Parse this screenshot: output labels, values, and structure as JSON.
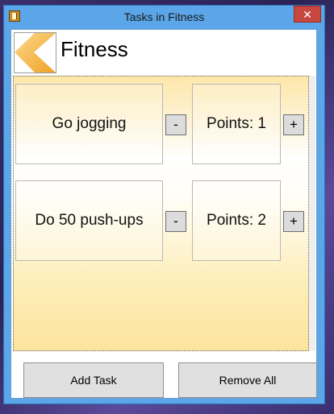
{
  "window": {
    "title": "Tasks in Fitness",
    "close_label": "✕"
  },
  "header": {
    "title": "Fitness"
  },
  "tasks": [
    {
      "name": "Go jogging",
      "points_label": "Points: 1",
      "minus": "-",
      "plus": "+"
    },
    {
      "name": "Do 50 push-ups",
      "points_label": "Points: 2",
      "minus": "-",
      "plus": "+"
    }
  ],
  "buttons": {
    "add_task": "Add Task",
    "remove_all": "Remove All"
  },
  "colors": {
    "back_arrow": "#f5b63d",
    "task_gradient": "#fde49e"
  }
}
